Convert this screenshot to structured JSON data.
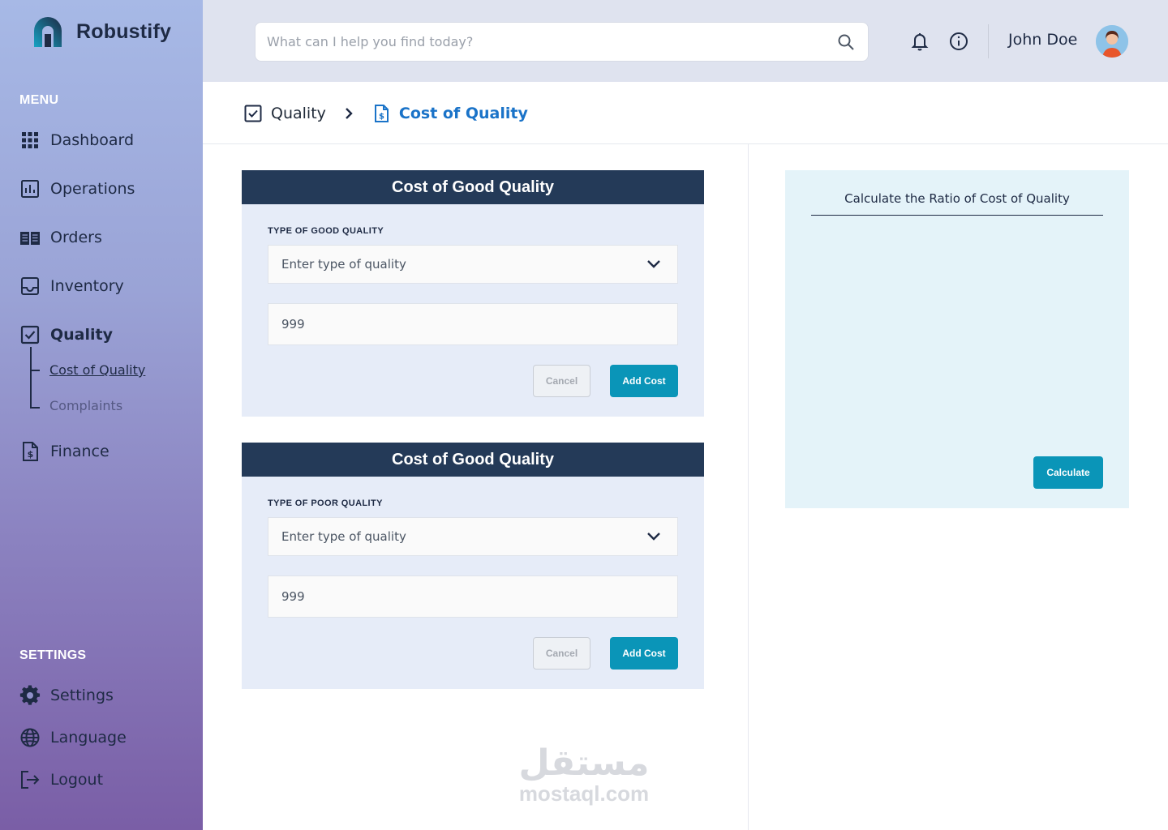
{
  "brand": {
    "name": "Robustify"
  },
  "sidebar": {
    "menu_heading": "MENU",
    "items": [
      {
        "label": "Dashboard",
        "icon": "grid-icon"
      },
      {
        "label": "Operations",
        "icon": "chart-icon"
      },
      {
        "label": "Orders",
        "icon": "book-icon"
      },
      {
        "label": "Inventory",
        "icon": "inbox-icon"
      },
      {
        "label": "Quality",
        "icon": "checkbox-icon",
        "active": true
      },
      {
        "label": "Finance",
        "icon": "invoice-icon"
      }
    ],
    "quality_sub": [
      {
        "label": "Cost of Quality",
        "current": true
      },
      {
        "label": "Complaints"
      }
    ],
    "settings_heading": "SETTINGS",
    "settings_items": [
      {
        "label": "Settings",
        "icon": "gear-icon"
      },
      {
        "label": "Language",
        "icon": "globe-icon"
      },
      {
        "label": "Logout",
        "icon": "logout-icon"
      }
    ]
  },
  "topbar": {
    "search_placeholder": "What can I help you find today?",
    "user_name": "John Doe"
  },
  "breadcrumb": {
    "parent": "Quality",
    "current": "Cost of Quality"
  },
  "cards": [
    {
      "title": "Cost of Good Quality",
      "field_label": "TYPE OF GOOD QUALITY",
      "select_placeholder": "Enter type of quality",
      "amount_placeholder": "999",
      "cancel_label": "Cancel",
      "add_label": "Add Cost"
    },
    {
      "title": "Cost of Good Quality",
      "field_label": "TYPE OF POOR QUALITY",
      "select_placeholder": "Enter type of quality",
      "amount_placeholder": "999",
      "cancel_label": "Cancel",
      "add_label": "Add Cost"
    }
  ],
  "ratio": {
    "title": "Calculate the Ratio of Cost of Quality",
    "button": "Calculate"
  },
  "watermark": {
    "arabic": "مستقل",
    "latin": "mostaql.com"
  },
  "colors": {
    "card_header": "#243a58",
    "accent_button": "#0a95b8",
    "breadcrumb_active": "#1a73c8",
    "ratio_bg": "#e4f3f9"
  }
}
